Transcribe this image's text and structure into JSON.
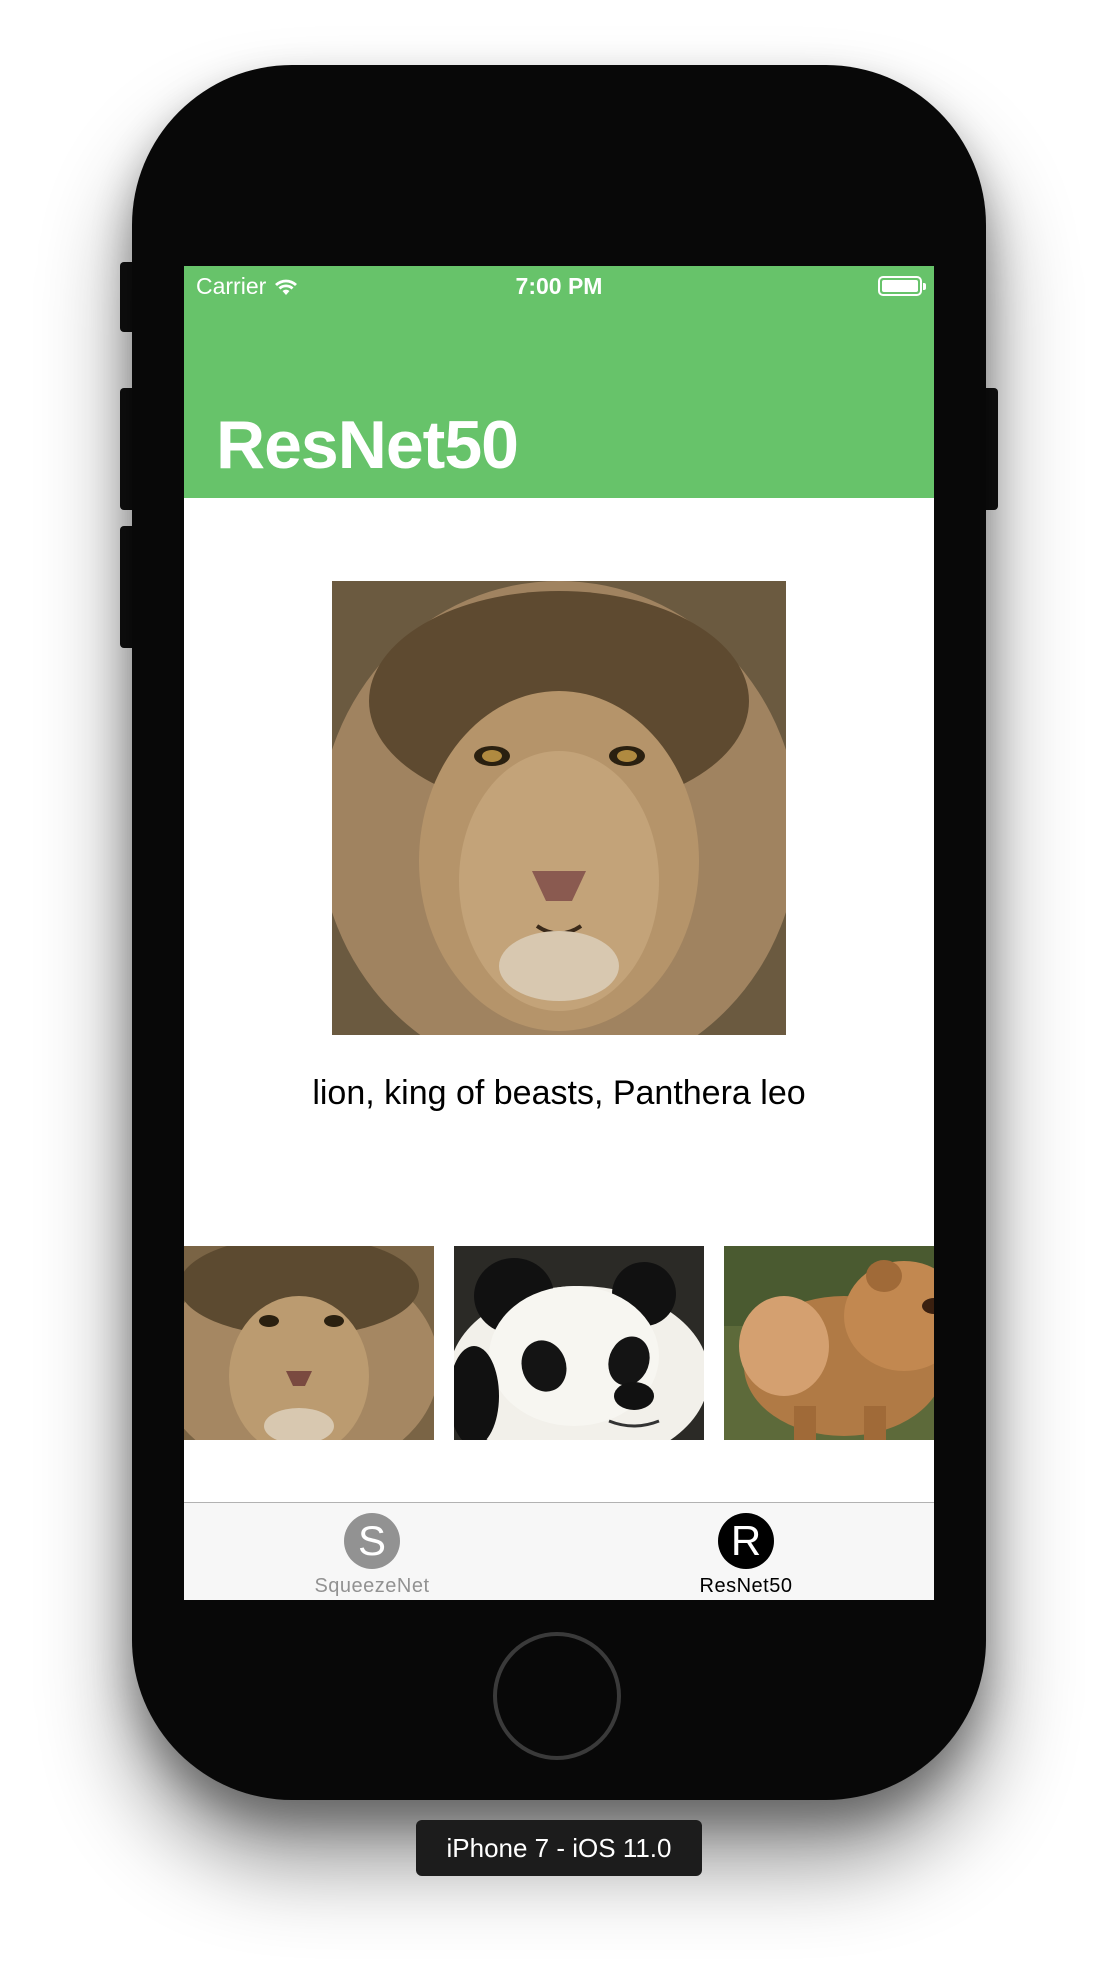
{
  "status_bar": {
    "carrier": "Carrier",
    "time": "7:00 PM",
    "battery_level": 1.0
  },
  "nav": {
    "title": "ResNet50",
    "color": "#67c36a"
  },
  "main": {
    "image": "lion-photo",
    "prediction": "lion, king of beasts, Panthera leo"
  },
  "thumbnails": [
    {
      "image": "lion-photo"
    },
    {
      "image": "panda-photo"
    },
    {
      "image": "dog-photo"
    }
  ],
  "tabs": [
    {
      "icon_letter": "S",
      "label": "SqueezeNet",
      "selected": false
    },
    {
      "icon_letter": "R",
      "label": "ResNet50",
      "selected": true
    }
  ],
  "simulator": {
    "device_label": "iPhone 7 - iOS 11.0"
  }
}
